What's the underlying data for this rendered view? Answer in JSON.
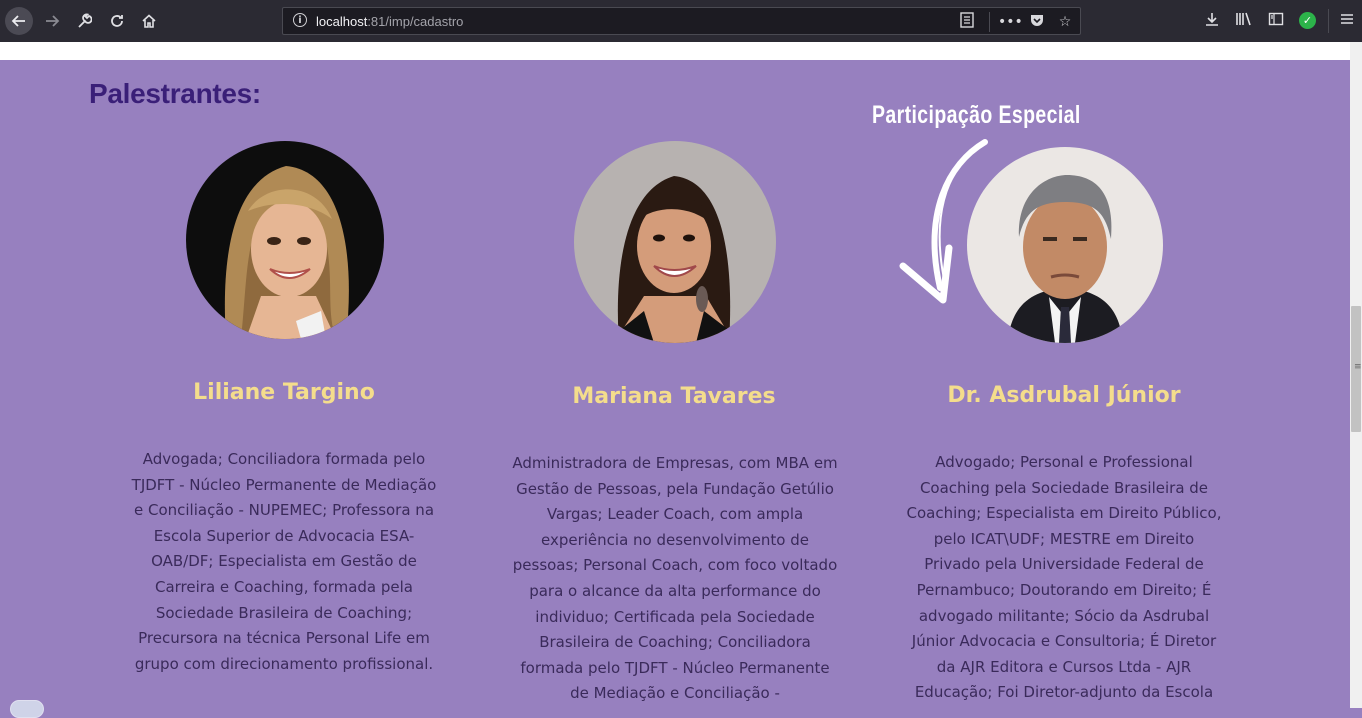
{
  "browser": {
    "url_host": "localhost",
    "url_rest": ":81/imp/cadastro",
    "icons": {
      "back": "back-arrow-icon",
      "forward": "forward-arrow-icon",
      "wrench": "wrench-icon",
      "reload": "reload-icon",
      "home": "home-icon",
      "site_info": "info-icon",
      "reader": "reader-view-icon",
      "more": "more-icon",
      "pocket": "pocket-icon",
      "bookmark": "star-icon",
      "download": "download-icon",
      "library": "library-icon",
      "sidebar": "sidebar-icon",
      "extension": "check-badge-icon",
      "menu": "hamburger-menu-icon"
    }
  },
  "section": {
    "title": "Palestrantes:",
    "special_label": "Participação Especial"
  },
  "speakers": [
    {
      "name": "Liliane Targino",
      "bio": "Advogada; Conciliadora formada pelo TJDFT - Núcleo Permanente de Mediação e Conciliação - NUPEMEC; Professora na Escola Superior de Advocacia ESA-OAB/DF; Especialista em Gestão de Carreira e Coaching, formada pela Sociedade Brasileira de Coaching; Precursora na técnica Personal Life em grupo com direcionamento profissional."
    },
    {
      "name": "Mariana Tavares",
      "bio": "Administradora de Empresas, com MBA em Gestão de Pessoas, pela Fundação Getúlio Vargas; Leader Coach, com ampla experiência no desenvolvimento de pessoas; Personal Coach, com foco voltado para o alcance da alta performance do individuo; Certificada pela Sociedade Brasileira de Coaching; Conciliadora formada pelo TJDFT - Núcleo Permanente de Mediação e Conciliação -"
    },
    {
      "name": "Dr. Asdrubal Júnior",
      "bio": "Advogado; Personal e Professional Coaching pela Sociedade Brasileira de Coaching; Especialista em Direito Público, pelo ICAT\\UDF; MESTRE em Direito Privado pela Universidade Federal de Pernambuco; Doutorando em Direito; É advogado militante; Sócio da Asdrubal Júnior Advocacia e Consultoria; É Diretor da AJR Editora e Cursos Ltda - AJR Educação; Foi Diretor-adjunto da Escola"
    }
  ],
  "colors": {
    "background": "#9780bf",
    "title": "#3a1f78",
    "name": "#f4dd8c",
    "bio": "#3a2a5a"
  }
}
